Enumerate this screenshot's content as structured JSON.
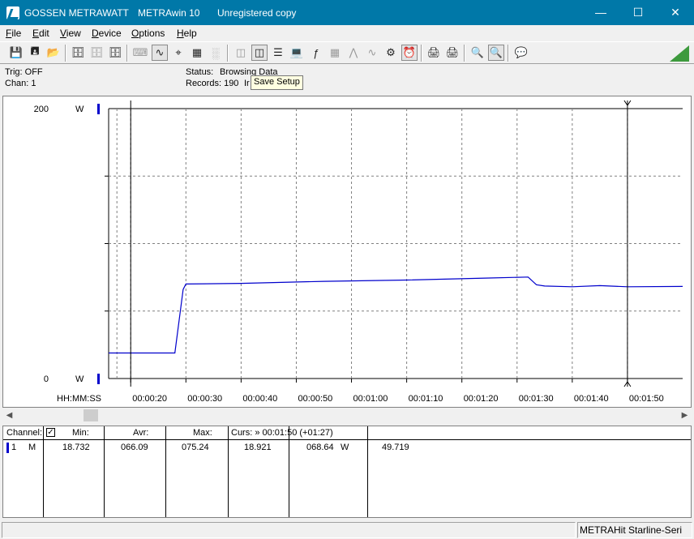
{
  "title": {
    "company": "GOSSEN METRAWATT",
    "app": "METRAwin 10",
    "license": "Unregistered copy"
  },
  "menu": [
    {
      "hot": "F",
      "rest": "ile"
    },
    {
      "hot": "E",
      "rest": "dit"
    },
    {
      "hot": "V",
      "rest": "iew"
    },
    {
      "hot": "D",
      "rest": "evice"
    },
    {
      "hot": "O",
      "rest": "ptions"
    },
    {
      "hot": "H",
      "rest": "elp"
    }
  ],
  "status": {
    "trig": "Trig: OFF",
    "chan": "Chan:  1",
    "status_label": "Status:",
    "status_value": "Browsing Data",
    "records": "Records: 190",
    "records_suffix": "Ir"
  },
  "tooltip": "Save Setup",
  "chart_data": {
    "type": "line",
    "y_top_label": "200",
    "y_bottom_label": "0",
    "y_unit_top": "W",
    "y_unit_bottom": "W",
    "ylim": [
      0,
      200
    ],
    "x_axis_label": "HH:MM:SS",
    "x_tick_labels": [
      "00:00:20",
      "00:00:30",
      "00:00:40",
      "00:00:50",
      "00:01:00",
      "00:01:10",
      "00:01:20",
      "00:01:30",
      "00:01:40",
      "00:01:50"
    ],
    "xlim_seconds": [
      16,
      120
    ],
    "cursor_seconds": [
      20,
      110
    ],
    "grid": true,
    "series_color": "#0000cc",
    "series": [
      {
        "x_seconds": [
          16,
          28,
          29.5,
          30,
          40,
          55,
          70,
          85,
          92,
          93.5,
          95,
          100,
          105,
          110,
          120
        ],
        "values": [
          18.9,
          18.9,
          66.0,
          70.0,
          70.5,
          72.0,
          73.0,
          74.5,
          75.2,
          69.5,
          68.5,
          68.0,
          68.8,
          68.0,
          68.2
        ]
      }
    ]
  },
  "table": {
    "headers": {
      "channel": "Channel:",
      "min": "Min:",
      "avr": "Avr:",
      "max": "Max:",
      "curs": "Curs: » 00:01:50 (+01:27)"
    },
    "row": {
      "num": "1",
      "mode": "M",
      "min": "18.732",
      "avr": "066.09",
      "max": "075.24",
      "c1": "18.921",
      "c2": "068.64",
      "unit": "W",
      "diff": "49.719"
    }
  },
  "statusbar": {
    "device": "METRAHit Starline-Seri"
  }
}
